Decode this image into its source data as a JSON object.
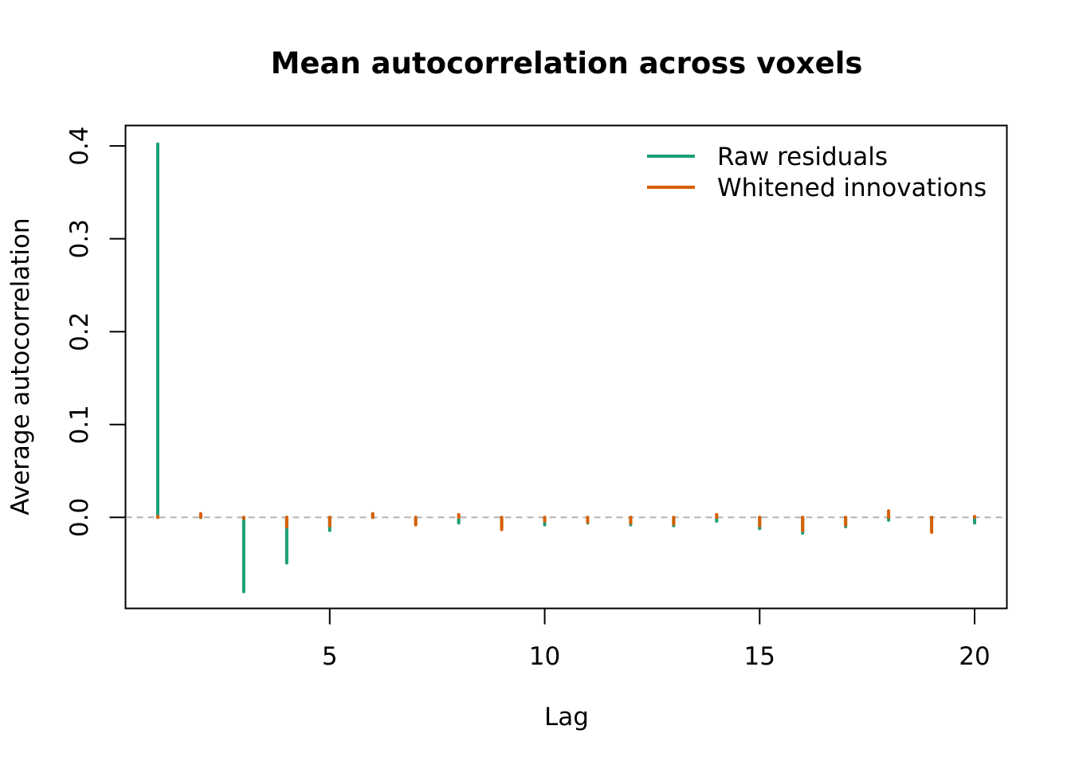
{
  "chart_data": {
    "type": "line",
    "subtype": "lag-stem",
    "title": "Mean autocorrelation across voxels",
    "xlabel": "Lag",
    "ylabel": "Average autocorrelation",
    "xlim": [
      0.25,
      20.75
    ],
    "ylim": [
      -0.098,
      0.422
    ],
    "x_ticks": [
      5,
      10,
      15,
      20
    ],
    "x_tick_labels": [
      "5",
      "10",
      "15",
      "20"
    ],
    "y_ticks": [
      0.0,
      0.1,
      0.2,
      0.3,
      0.4
    ],
    "y_tick_labels": [
      "0.0",
      "0.1",
      "0.2",
      "0.3",
      "0.4"
    ],
    "reference_line": {
      "y": 0.0,
      "style": "dashed",
      "color": "#b3b3b3"
    },
    "legend_position": "top-right",
    "grid": false,
    "x": [
      1,
      2,
      3,
      4,
      5,
      6,
      7,
      8,
      9,
      10,
      11,
      12,
      13,
      14,
      15,
      16,
      17,
      18,
      19,
      20
    ],
    "series": [
      {
        "name": "Raw residuals",
        "color": "#1b9e77",
        "values": [
          0.402,
          0.002,
          -0.08,
          -0.049,
          -0.014,
          0.004,
          -0.007,
          -0.006,
          -0.012,
          -0.008,
          -0.006,
          -0.008,
          -0.009,
          -0.004,
          -0.012,
          -0.017,
          -0.01,
          -0.003,
          -0.011,
          -0.006
        ]
      },
      {
        "name": "Whitened innovations",
        "color": "#d95f02",
        "values": [
          0.001,
          0.004,
          -0.001,
          -0.01,
          -0.009,
          0.004,
          -0.008,
          0.003,
          -0.013,
          -0.004,
          -0.005,
          -0.006,
          -0.007,
          0.003,
          -0.009,
          -0.014,
          -0.008,
          0.007,
          -0.016,
          0.001
        ]
      }
    ]
  }
}
